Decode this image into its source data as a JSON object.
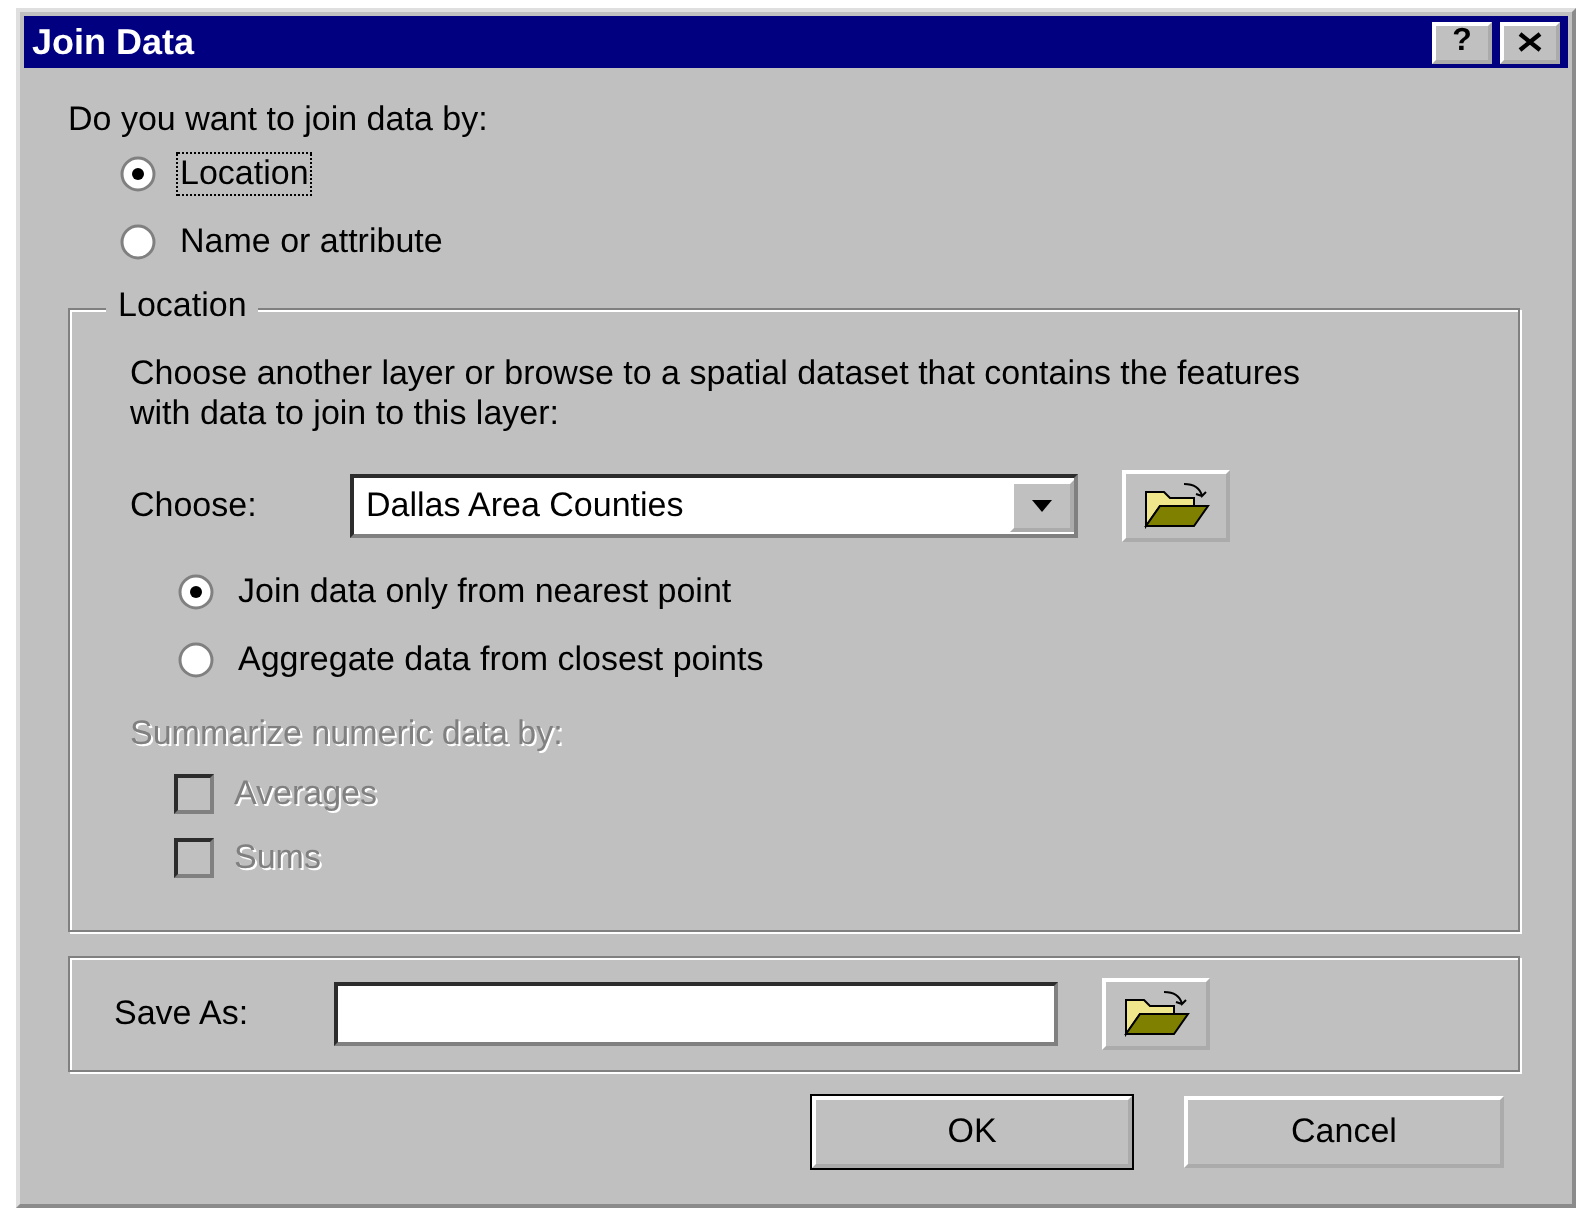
{
  "window": {
    "title": "Join Data",
    "title_buttons": [
      {
        "kind": "help",
        "label": "?"
      },
      {
        "kind": "close"
      }
    ]
  },
  "join_by": {
    "prompt": "Do you want to join data by:",
    "options": [
      {
        "label": "Location",
        "selected": true,
        "focused": true
      },
      {
        "label": "Name or attribute",
        "selected": false,
        "focused": false
      }
    ]
  },
  "location_group": {
    "title": "Location",
    "description": "Choose another layer or browse to a spatial dataset that contains the features with data to join to this layer:",
    "choose": {
      "label": "Choose:",
      "value": "Dallas Area Counties"
    },
    "options": [
      {
        "label": "Join data only from nearest point",
        "selected": true
      },
      {
        "label": "Aggregate data from closest points",
        "selected": false
      }
    ],
    "summarize": {
      "label": "Summarize numeric data by:",
      "disabled": true,
      "options": [
        {
          "label": "Averages",
          "checked": false
        },
        {
          "label": "Sums",
          "checked": false
        }
      ]
    }
  },
  "save_as": {
    "label": "Save As:"
  },
  "buttons": [
    {
      "label": "OK",
      "default": true
    },
    {
      "label": "Cancel",
      "default": false
    }
  ]
}
